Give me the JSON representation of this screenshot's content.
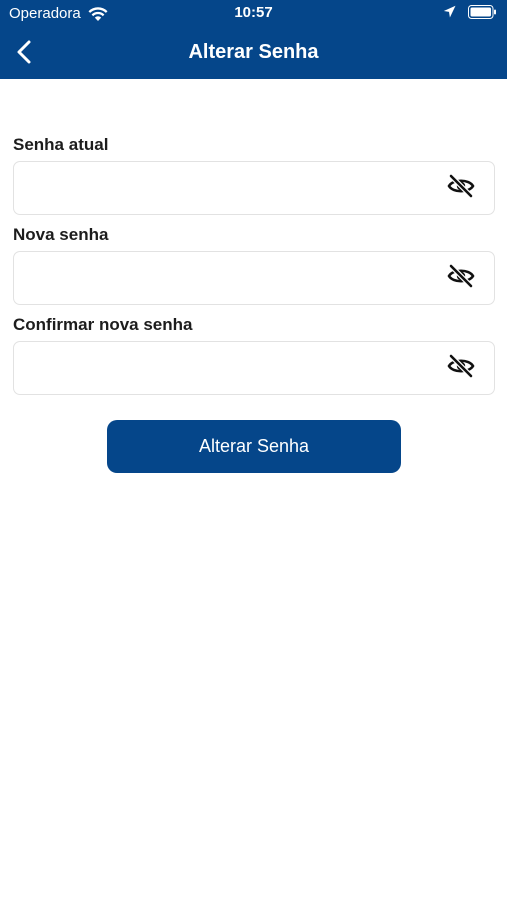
{
  "status_bar": {
    "carrier": "Operadora",
    "time": "10:57",
    "icons": [
      "wifi-icon",
      "location-arrow-icon",
      "battery-icon"
    ]
  },
  "header": {
    "title": "Alterar Senha",
    "back_icon": "chevron-left-icon",
    "background_color": "#05468a"
  },
  "form": {
    "fields": [
      {
        "label": "Senha atual",
        "value": "",
        "toggle_icon": "eye-off-icon"
      },
      {
        "label": "Nova senha",
        "value": "",
        "toggle_icon": "eye-off-icon"
      },
      {
        "label": "Confirmar nova senha",
        "value": "",
        "toggle_icon": "eye-off-icon"
      }
    ],
    "submit_label": "Alterar Senha"
  },
  "colors": {
    "primary": "#05468a",
    "text": "#1d1d1d",
    "field_border": "#e2e2e2"
  }
}
